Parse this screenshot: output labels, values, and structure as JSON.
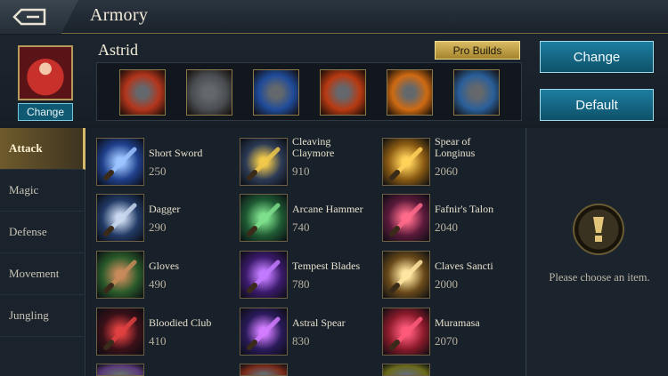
{
  "window": {
    "title": "Armory"
  },
  "hero": {
    "name": "Astrid",
    "change_label": "Change",
    "pro_builds_label": "Pro Builds",
    "build_slots": [
      {
        "icon": "armor-item-icon",
        "bg": "#b3351c"
      },
      {
        "icon": "boots-item-icon",
        "bg": "#4a4e52"
      },
      {
        "icon": "sword-item-icon",
        "bg": "#1f4b9a"
      },
      {
        "icon": "talisman-item-icon",
        "bg": "#b83a12"
      },
      {
        "icon": "amulet-item-icon",
        "bg": "#cf6a12"
      },
      {
        "icon": "blade-item-icon",
        "bg": "#2a5f9a"
      }
    ]
  },
  "actions": {
    "change_label": "Change",
    "default_label": "Default"
  },
  "categories": [
    {
      "label": "Attack",
      "active": true
    },
    {
      "label": "Magic",
      "active": false
    },
    {
      "label": "Defense",
      "active": false
    },
    {
      "label": "Movement",
      "active": false
    },
    {
      "label": "Jungling",
      "active": false
    }
  ],
  "items": [
    {
      "name": "Short Sword",
      "price": "250",
      "icon": "short-sword-icon",
      "bg": "#1f3f8a",
      "glow": "#9cc4ff"
    },
    {
      "name": "Cleaving Claymore",
      "price": "910",
      "icon": "cleaving-claymore-icon",
      "bg": "#2c3a55",
      "glow": "#f0c84a"
    },
    {
      "name": "Spear of Longinus",
      "price": "2060",
      "icon": "spear-of-longinus-icon",
      "bg": "#8a5a12",
      "glow": "#ffd25a"
    },
    {
      "name": "Dagger",
      "price": "290",
      "icon": "dagger-icon",
      "bg": "#223a66",
      "glow": "#c9d8ee"
    },
    {
      "name": "Arcane Hammer",
      "price": "740",
      "icon": "arcane-hammer-icon",
      "bg": "#1f5a33",
      "glow": "#7ee08c"
    },
    {
      "name": "Fafnir's Talon",
      "price": "2040",
      "icon": "fafnirs-talon-icon",
      "bg": "#5a1a3a",
      "glow": "#ff6a8a"
    },
    {
      "name": "Gloves",
      "price": "490",
      "icon": "gloves-icon",
      "bg": "#2a5a2a",
      "glow": "#c88a5a"
    },
    {
      "name": "Tempest Blades",
      "price": "780",
      "icon": "tempest-blades-icon",
      "bg": "#3a1a6a",
      "glow": "#c27aff"
    },
    {
      "name": "Claves Sancti",
      "price": "2000",
      "icon": "claves-sancti-icon",
      "bg": "#6a4a1a",
      "glow": "#ffe6a0"
    },
    {
      "name": "Bloodied Club",
      "price": "410",
      "icon": "bloodied-club-icon",
      "bg": "#3a1018",
      "glow": "#e04040"
    },
    {
      "name": "Astral Spear",
      "price": "830",
      "icon": "astral-spear-icon",
      "bg": "#2a1a5a",
      "glow": "#d27cff"
    },
    {
      "name": "Muramasa",
      "price": "2070",
      "icon": "muramasa-icon",
      "bg": "#8a1a2a",
      "glow": "#ff5a7a"
    }
  ],
  "partial_row_icons": [
    {
      "icon": "partial-item-icon",
      "bg": "#5a3a7a"
    },
    {
      "icon": "partial-item-icon",
      "bg": "#7a2a1a"
    },
    {
      "icon": "partial-item-icon",
      "bg": "#6a6a1a"
    }
  ],
  "detail": {
    "hint": "Please choose an item.",
    "icon": "exclamation-icon"
  },
  "colors": {
    "accent_gold": "#d6b96b",
    "button_blue": "#1d7ea1"
  }
}
